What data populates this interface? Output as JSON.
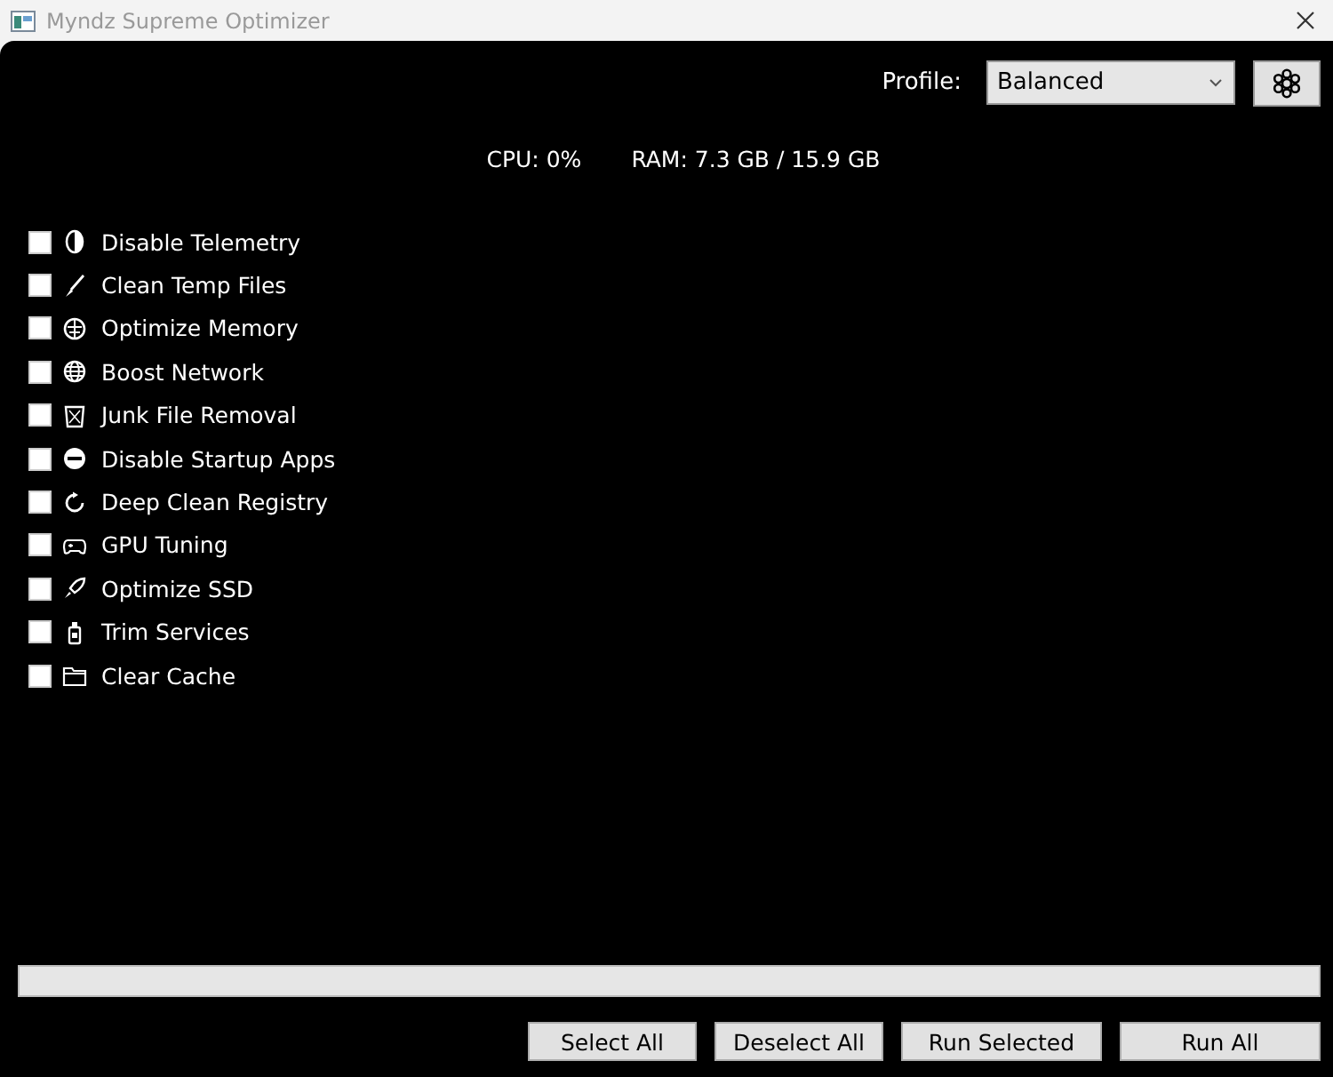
{
  "window": {
    "title": "Myndz Supreme Optimizer"
  },
  "profile": {
    "label": "Profile:",
    "value": "Balanced"
  },
  "stats": {
    "cpu": "CPU: 0%",
    "ram": "RAM: 7.3 GB / 15.9 GB"
  },
  "tasks": [
    {
      "label": "Disable Telemetry",
      "checked": false
    },
    {
      "label": "Clean Temp Files",
      "checked": false
    },
    {
      "label": "Optimize Memory",
      "checked": false
    },
    {
      "label": "Boost Network",
      "checked": false
    },
    {
      "label": "Junk File Removal",
      "checked": false
    },
    {
      "label": "Disable Startup Apps",
      "checked": false
    },
    {
      "label": "Deep Clean Registry",
      "checked": false
    },
    {
      "label": "GPU Tuning",
      "checked": false
    },
    {
      "label": "Optimize SSD",
      "checked": false
    },
    {
      "label": "Trim Services",
      "checked": false
    },
    {
      "label": "Clear Cache",
      "checked": false
    }
  ],
  "progress": {
    "level": 0
  },
  "buttons": [
    "Select All",
    "Deselect All",
    "Run Selected",
    "Run All"
  ]
}
